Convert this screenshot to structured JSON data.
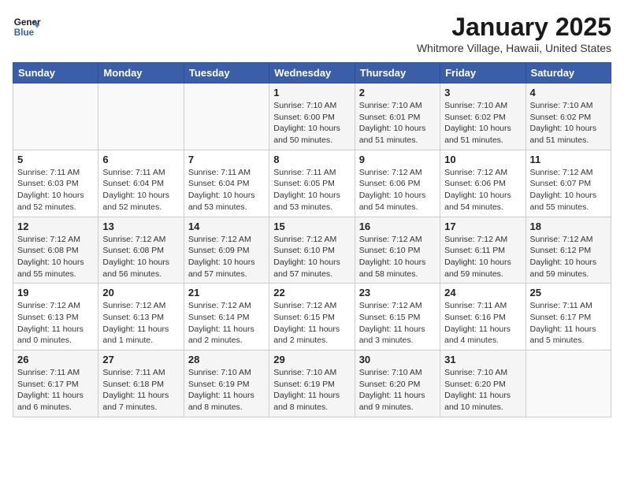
{
  "header": {
    "logo_line1": "General",
    "logo_line2": "Blue",
    "title": "January 2025",
    "subtitle": "Whitmore Village, Hawaii, United States"
  },
  "weekdays": [
    "Sunday",
    "Monday",
    "Tuesday",
    "Wednesday",
    "Thursday",
    "Friday",
    "Saturday"
  ],
  "weeks": [
    [
      {
        "day": "",
        "info": ""
      },
      {
        "day": "",
        "info": ""
      },
      {
        "day": "",
        "info": ""
      },
      {
        "day": "1",
        "info": "Sunrise: 7:10 AM\nSunset: 6:00 PM\nDaylight: 10 hours\nand 50 minutes."
      },
      {
        "day": "2",
        "info": "Sunrise: 7:10 AM\nSunset: 6:01 PM\nDaylight: 10 hours\nand 51 minutes."
      },
      {
        "day": "3",
        "info": "Sunrise: 7:10 AM\nSunset: 6:02 PM\nDaylight: 10 hours\nand 51 minutes."
      },
      {
        "day": "4",
        "info": "Sunrise: 7:10 AM\nSunset: 6:02 PM\nDaylight: 10 hours\nand 51 minutes."
      }
    ],
    [
      {
        "day": "5",
        "info": "Sunrise: 7:11 AM\nSunset: 6:03 PM\nDaylight: 10 hours\nand 52 minutes."
      },
      {
        "day": "6",
        "info": "Sunrise: 7:11 AM\nSunset: 6:04 PM\nDaylight: 10 hours\nand 52 minutes."
      },
      {
        "day": "7",
        "info": "Sunrise: 7:11 AM\nSunset: 6:04 PM\nDaylight: 10 hours\nand 53 minutes."
      },
      {
        "day": "8",
        "info": "Sunrise: 7:11 AM\nSunset: 6:05 PM\nDaylight: 10 hours\nand 53 minutes."
      },
      {
        "day": "9",
        "info": "Sunrise: 7:12 AM\nSunset: 6:06 PM\nDaylight: 10 hours\nand 54 minutes."
      },
      {
        "day": "10",
        "info": "Sunrise: 7:12 AM\nSunset: 6:06 PM\nDaylight: 10 hours\nand 54 minutes."
      },
      {
        "day": "11",
        "info": "Sunrise: 7:12 AM\nSunset: 6:07 PM\nDaylight: 10 hours\nand 55 minutes."
      }
    ],
    [
      {
        "day": "12",
        "info": "Sunrise: 7:12 AM\nSunset: 6:08 PM\nDaylight: 10 hours\nand 55 minutes."
      },
      {
        "day": "13",
        "info": "Sunrise: 7:12 AM\nSunset: 6:08 PM\nDaylight: 10 hours\nand 56 minutes."
      },
      {
        "day": "14",
        "info": "Sunrise: 7:12 AM\nSunset: 6:09 PM\nDaylight: 10 hours\nand 57 minutes."
      },
      {
        "day": "15",
        "info": "Sunrise: 7:12 AM\nSunset: 6:10 PM\nDaylight: 10 hours\nand 57 minutes."
      },
      {
        "day": "16",
        "info": "Sunrise: 7:12 AM\nSunset: 6:10 PM\nDaylight: 10 hours\nand 58 minutes."
      },
      {
        "day": "17",
        "info": "Sunrise: 7:12 AM\nSunset: 6:11 PM\nDaylight: 10 hours\nand 59 minutes."
      },
      {
        "day": "18",
        "info": "Sunrise: 7:12 AM\nSunset: 6:12 PM\nDaylight: 10 hours\nand 59 minutes."
      }
    ],
    [
      {
        "day": "19",
        "info": "Sunrise: 7:12 AM\nSunset: 6:13 PM\nDaylight: 11 hours\nand 0 minutes."
      },
      {
        "day": "20",
        "info": "Sunrise: 7:12 AM\nSunset: 6:13 PM\nDaylight: 11 hours\nand 1 minute."
      },
      {
        "day": "21",
        "info": "Sunrise: 7:12 AM\nSunset: 6:14 PM\nDaylight: 11 hours\nand 2 minutes."
      },
      {
        "day": "22",
        "info": "Sunrise: 7:12 AM\nSunset: 6:15 PM\nDaylight: 11 hours\nand 2 minutes."
      },
      {
        "day": "23",
        "info": "Sunrise: 7:12 AM\nSunset: 6:15 PM\nDaylight: 11 hours\nand 3 minutes."
      },
      {
        "day": "24",
        "info": "Sunrise: 7:11 AM\nSunset: 6:16 PM\nDaylight: 11 hours\nand 4 minutes."
      },
      {
        "day": "25",
        "info": "Sunrise: 7:11 AM\nSunset: 6:17 PM\nDaylight: 11 hours\nand 5 minutes."
      }
    ],
    [
      {
        "day": "26",
        "info": "Sunrise: 7:11 AM\nSunset: 6:17 PM\nDaylight: 11 hours\nand 6 minutes."
      },
      {
        "day": "27",
        "info": "Sunrise: 7:11 AM\nSunset: 6:18 PM\nDaylight: 11 hours\nand 7 minutes."
      },
      {
        "day": "28",
        "info": "Sunrise: 7:10 AM\nSunset: 6:19 PM\nDaylight: 11 hours\nand 8 minutes."
      },
      {
        "day": "29",
        "info": "Sunrise: 7:10 AM\nSunset: 6:19 PM\nDaylight: 11 hours\nand 8 minutes."
      },
      {
        "day": "30",
        "info": "Sunrise: 7:10 AM\nSunset: 6:20 PM\nDaylight: 11 hours\nand 9 minutes."
      },
      {
        "day": "31",
        "info": "Sunrise: 7:10 AM\nSunset: 6:20 PM\nDaylight: 11 hours\nand 10 minutes."
      },
      {
        "day": "",
        "info": ""
      }
    ]
  ]
}
